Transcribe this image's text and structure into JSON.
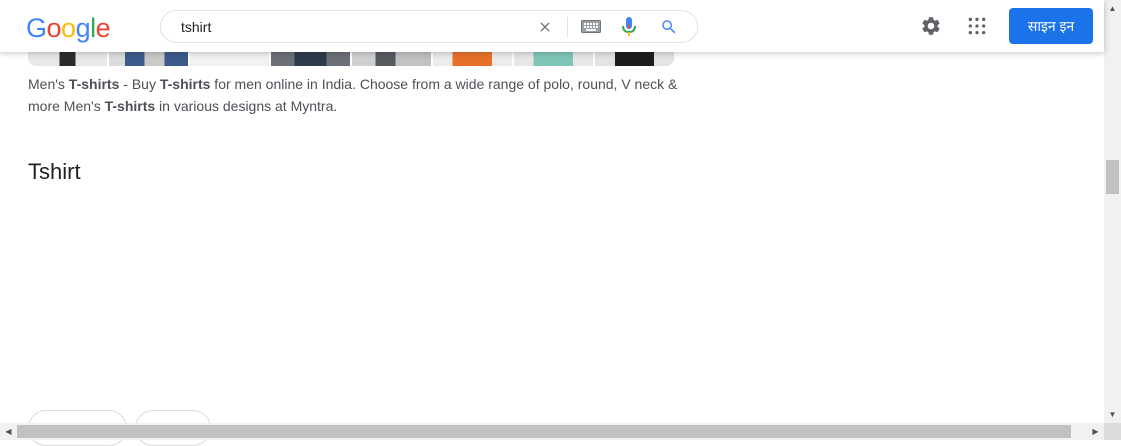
{
  "logo": {
    "letters": [
      "G",
      "o",
      "o",
      "g",
      "l",
      "e"
    ],
    "colors": [
      "#4285F4",
      "#EA4335",
      "#FBBC05",
      "#4285F4",
      "#34A853",
      "#EA4335"
    ]
  },
  "search": {
    "value": "tshirt"
  },
  "icons": {
    "clear": "close-icon",
    "keyboard": "keyboard-icon",
    "voice": "microphone-icon",
    "search": "search-icon",
    "settings": "gear-icon",
    "apps": "apps-grid-icon"
  },
  "header": {
    "signin_label": "साइन इन",
    "signin_color": "#1a73e8"
  },
  "result": {
    "snippet_parts": [
      {
        "text": "Men's ",
        "bold": false
      },
      {
        "text": "T-shirts",
        "bold": true
      },
      {
        "text": " - Buy ",
        "bold": false
      },
      {
        "text": "T-shirts",
        "bold": true
      },
      {
        "text": " for men online in India. Choose from a wide range of polo, round, V neck & more Men's ",
        "bold": false
      },
      {
        "text": "T-shirts",
        "bold": true
      },
      {
        "text": " in various designs at Myntra.",
        "bold": false
      }
    ]
  },
  "section": {
    "title": "Tshirt"
  }
}
